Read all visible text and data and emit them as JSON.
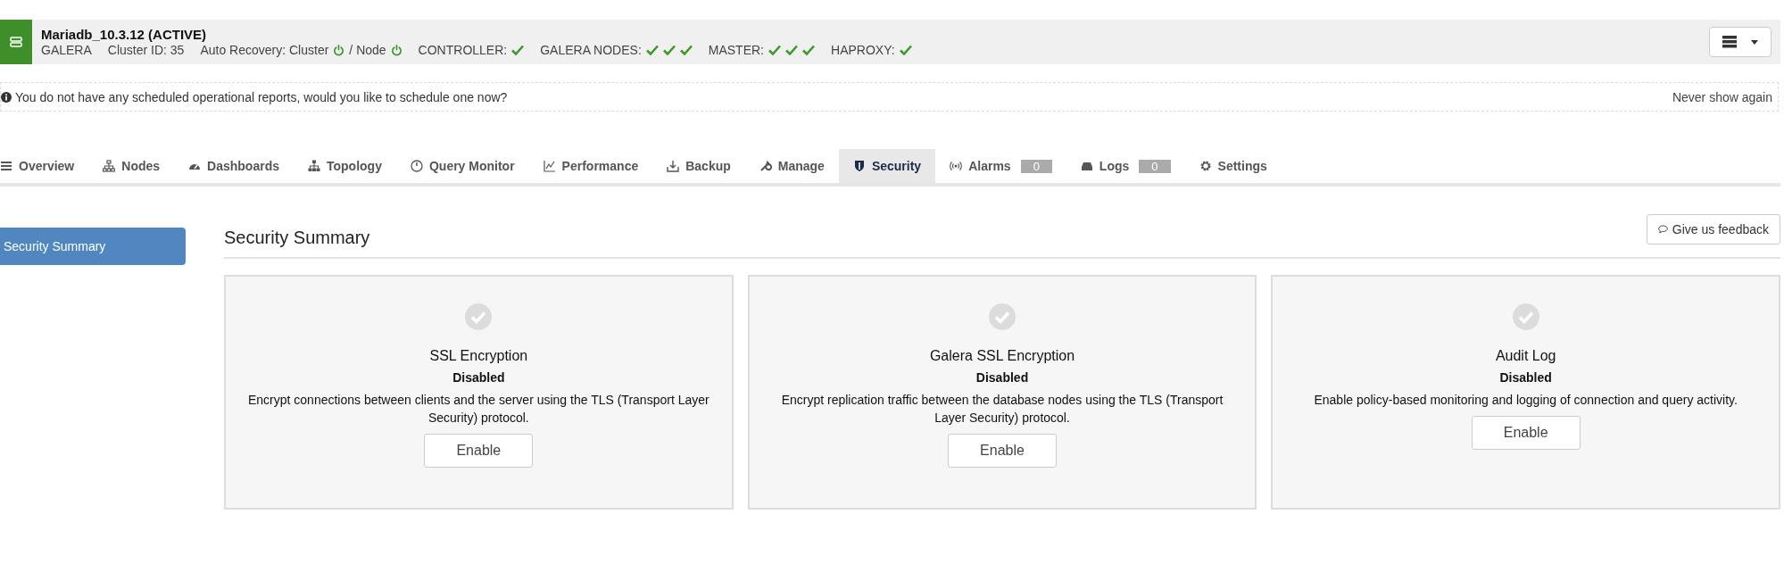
{
  "cluster": {
    "title": "Mariadb_10.3.12 (ACTIVE)",
    "items": [
      {
        "kind": "text",
        "label": "GALERA"
      },
      {
        "kind": "text",
        "label": "Cluster ID: 35"
      },
      {
        "kind": "power",
        "label": "Auto Recovery: Cluster",
        "on": true
      },
      {
        "kind": "power",
        "label": "/ Node",
        "on": true
      },
      {
        "kind": "checks",
        "label": "CONTROLLER:",
        "checks": [
          {
            "ok": true
          }
        ]
      },
      {
        "kind": "checks",
        "label": "GALERA NODES:",
        "checks": [
          {
            "ok": true
          },
          {
            "ok": true
          },
          {
            "ok": true
          }
        ]
      },
      {
        "kind": "checks",
        "label": "MASTER:",
        "checks": [
          {
            "ok": true
          },
          {
            "ok": true
          },
          {
            "ok": true
          }
        ]
      },
      {
        "kind": "checks",
        "label": "HAPROXY:",
        "checks": [
          {
            "ok": true
          }
        ]
      }
    ]
  },
  "notice": {
    "text": "You do not have any scheduled operational reports, would you like to schedule one now?",
    "dismiss": "Never show again"
  },
  "tabs": [
    {
      "label": "Overview",
      "selected": false
    },
    {
      "label": "Nodes",
      "selected": false
    },
    {
      "label": "Dashboards",
      "selected": false
    },
    {
      "label": "Topology",
      "selected": false
    },
    {
      "label": "Query Monitor",
      "selected": false
    },
    {
      "label": "Performance",
      "selected": false
    },
    {
      "label": "Backup",
      "selected": false
    },
    {
      "label": "Manage",
      "selected": false
    },
    {
      "label": "Security",
      "selected": true
    },
    {
      "label": "Alarms",
      "selected": false,
      "badge": "0"
    },
    {
      "label": "Logs",
      "selected": false,
      "badge": "0"
    },
    {
      "label": "Settings",
      "selected": false
    }
  ],
  "sidebar": {
    "items": [
      {
        "label": "Security Summary",
        "selected": true
      }
    ]
  },
  "section": {
    "title": "Security Summary",
    "feedback_button": "Give us feedback"
  },
  "cards": [
    {
      "title": "SSL Encryption",
      "enabled": false,
      "status": "Disabled",
      "description": "Encrypt connections between clients and the server using the TLS (Transport Layer Security) protocol.",
      "button": "Enable"
    },
    {
      "title": "Galera SSL Encryption",
      "enabled": false,
      "status": "Disabled",
      "description": "Encrypt replication traffic between the database nodes using the TLS (Transport Layer Security) protocol.",
      "button": "Enable"
    },
    {
      "title": "Audit Log",
      "enabled": false,
      "status": "Disabled",
      "description": "Enable policy-based monitoring and logging of connection and query activity.",
      "button": "Enable"
    }
  ]
}
